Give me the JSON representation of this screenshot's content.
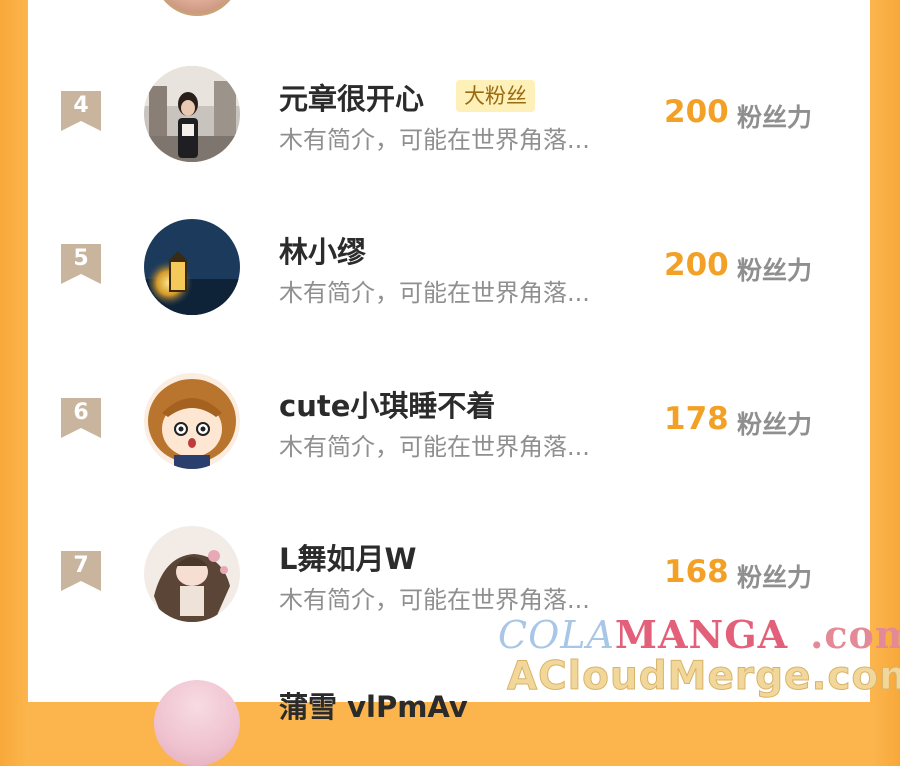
{
  "list": {
    "bio_text": "木有简介，可能在世界角落...",
    "score_unit": "粉丝力",
    "entries": [
      {
        "rank": "4",
        "name": "元章很开心",
        "tag": "大粉丝",
        "score": "200",
        "avatar": "photo-girl-street-avatar"
      },
      {
        "rank": "5",
        "name": "林小缪",
        "tag": "",
        "score": "200",
        "avatar": "lantern-night-avatar"
      },
      {
        "rank": "6",
        "name": "cute小琪睡不着",
        "tag": "",
        "score": "178",
        "avatar": "anime-girl-avatar"
      },
      {
        "rank": "7",
        "name": "L舞如月W",
        "tag": "",
        "score": "168",
        "avatar": "illustrated-girl-avatar"
      }
    ],
    "partial_next_name": "蒲雪 vlPmAv"
  },
  "watermark": {
    "line1_part1": "COLA",
    "line1_part2": "MANGA",
    "line1_part3": ".com",
    "line2": "ACloudMerge.com"
  },
  "colors": {
    "accent_orange": "#f2a126",
    "background_orange": "#fbb54c",
    "rank_badge": "#c9b59e",
    "fan_tag_bg": "#fdf0b8"
  }
}
